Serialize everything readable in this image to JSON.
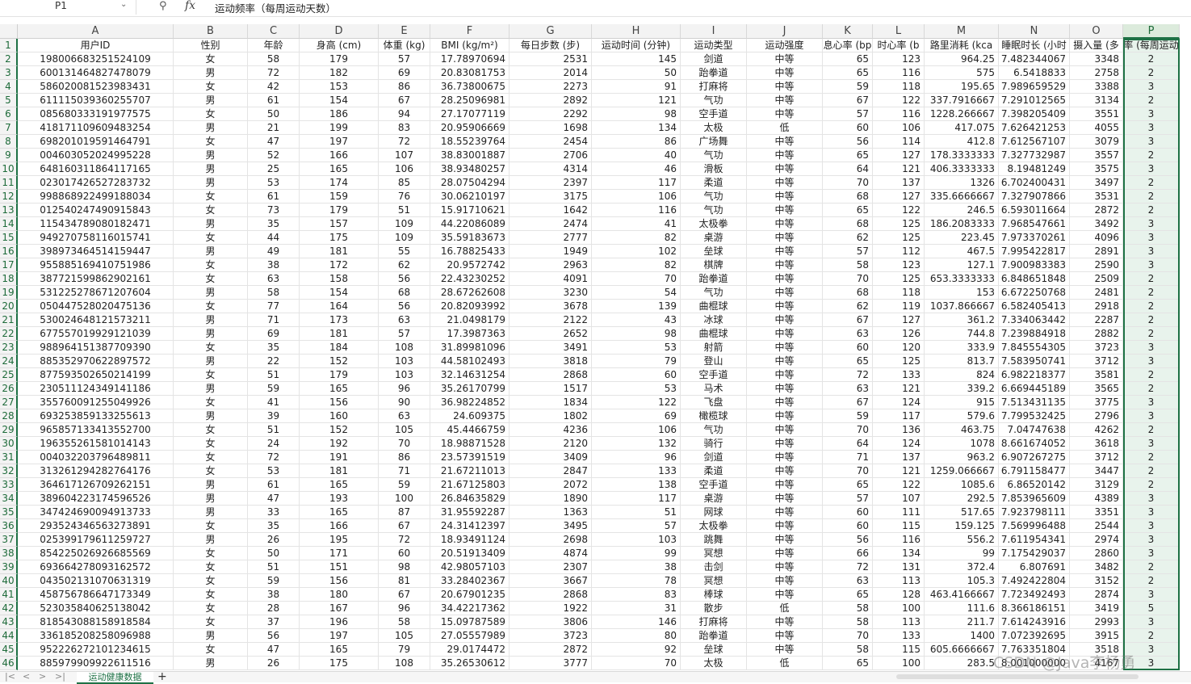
{
  "formula_bar": {
    "name_box": "P1",
    "fx": "fx",
    "formula": "运动频率（每周运动天数）"
  },
  "columns": [
    "A",
    "B",
    "C",
    "D",
    "E",
    "F",
    "G",
    "H",
    "I",
    "J",
    "K",
    "L",
    "M",
    "N",
    "O",
    "P"
  ],
  "headers": [
    "用户ID",
    "性别",
    "年龄",
    "身高 (cm)",
    "体重 (kg)",
    "BMI (kg/m²)",
    "每日步数 (步)",
    "运动时间 (分钟)",
    "运动类型",
    "运动强度",
    "息心率 (bp",
    "时心率 (b",
    "路里消耗 (kca",
    "睡眠时长 (小时",
    "摄入量 (多",
    "率 (每周运动"
  ],
  "rows": [
    [
      "198006683251524109",
      "女",
      "58",
      "179",
      "57",
      "17.78970694",
      "2531",
      "145",
      "剑道",
      "中等",
      "65",
      "123",
      "964.25",
      "7.482344067",
      "3348",
      "2"
    ],
    [
      "600131464827478079",
      "男",
      "72",
      "182",
      "69",
      "20.83081753",
      "2014",
      "50",
      "跆拳道",
      "中等",
      "65",
      "116",
      "575",
      "6.5418833",
      "2758",
      "2"
    ],
    [
      "586020081523983431",
      "女",
      "42",
      "153",
      "86",
      "36.73800675",
      "2273",
      "91",
      "打麻将",
      "中等",
      "59",
      "118",
      "195.65",
      "7.989659529",
      "3388",
      "3"
    ],
    [
      "611115039360255707",
      "男",
      "61",
      "154",
      "67",
      "28.25096981",
      "2892",
      "121",
      "气功",
      "中等",
      "67",
      "122",
      "337.7916667",
      "7.291012565",
      "3134",
      "2"
    ],
    [
      "085680333191977575",
      "女",
      "50",
      "186",
      "94",
      "27.17077119",
      "2292",
      "98",
      "空手道",
      "中等",
      "57",
      "116",
      "1228.266667",
      "7.398205409",
      "3551",
      "3"
    ],
    [
      "418171109609483254",
      "男",
      "21",
      "199",
      "83",
      "20.95906669",
      "1698",
      "134",
      "太极",
      "低",
      "60",
      "106",
      "417.075",
      "7.626421253",
      "4055",
      "3"
    ],
    [
      "698201019591464791",
      "女",
      "47",
      "197",
      "72",
      "18.55239764",
      "2454",
      "86",
      "广场舞",
      "中等",
      "56",
      "114",
      "412.8",
      "7.612567107",
      "3079",
      "3"
    ],
    [
      "004603052024995228",
      "男",
      "52",
      "166",
      "107",
      "38.83001887",
      "2706",
      "40",
      "气功",
      "中等",
      "65",
      "127",
      "178.3333333",
      "7.327732987",
      "3557",
      "2"
    ],
    [
      "648160311864117165",
      "男",
      "25",
      "165",
      "106",
      "38.93480257",
      "4314",
      "46",
      "滑板",
      "中等",
      "64",
      "121",
      "406.3333333",
      "8.19481249",
      "3575",
      "3"
    ],
    [
      "023017426527283732",
      "男",
      "53",
      "174",
      "85",
      "28.07504294",
      "2397",
      "117",
      "柔道",
      "中等",
      "70",
      "137",
      "1326",
      "6.702400431",
      "3497",
      "2"
    ],
    [
      "998868922499188034",
      "女",
      "61",
      "159",
      "76",
      "30.06210197",
      "3175",
      "106",
      "气功",
      "中等",
      "68",
      "127",
      "335.6666667",
      "7.327907866",
      "3531",
      "2"
    ],
    [
      "012540247490915843",
      "女",
      "73",
      "179",
      "51",
      "15.91710621",
      "1642",
      "116",
      "气功",
      "中等",
      "65",
      "122",
      "246.5",
      "6.593011664",
      "2872",
      "2"
    ],
    [
      "115434789080182471",
      "男",
      "35",
      "157",
      "109",
      "44.22086089",
      "2474",
      "41",
      "太极拳",
      "中等",
      "68",
      "125",
      "186.2083333",
      "7.968547661",
      "3492",
      "3"
    ],
    [
      "949270758116015741",
      "女",
      "44",
      "175",
      "109",
      "35.59183673",
      "2777",
      "82",
      "桌游",
      "中等",
      "62",
      "125",
      "223.45",
      "7.973370261",
      "4096",
      "3"
    ],
    [
      "398973464514159447",
      "男",
      "49",
      "181",
      "55",
      "16.78825433",
      "1949",
      "102",
      "垒球",
      "中等",
      "57",
      "112",
      "467.5",
      "7.995422817",
      "2891",
      "3"
    ],
    [
      "955885169410751986",
      "女",
      "38",
      "172",
      "62",
      "20.9572742",
      "2963",
      "82",
      "棋牌",
      "中等",
      "58",
      "123",
      "127.1",
      "7.900983383",
      "2590",
      "3"
    ],
    [
      "387721599862902161",
      "女",
      "63",
      "158",
      "56",
      "22.43230252",
      "4091",
      "70",
      "跆拳道",
      "中等",
      "70",
      "125",
      "653.3333333",
      "6.848651848",
      "2509",
      "2"
    ],
    [
      "531225278671207604",
      "男",
      "58",
      "154",
      "68",
      "28.67262608",
      "3230",
      "54",
      "气功",
      "中等",
      "68",
      "118",
      "153",
      "6.672250768",
      "2481",
      "2"
    ],
    [
      "050447528020475136",
      "女",
      "77",
      "164",
      "56",
      "20.82093992",
      "3678",
      "139",
      "曲棍球",
      "中等",
      "62",
      "119",
      "1037.866667",
      "6.582405413",
      "2918",
      "2"
    ],
    [
      "530024648121573211",
      "男",
      "71",
      "173",
      "63",
      "21.0498179",
      "2122",
      "43",
      "冰球",
      "中等",
      "67",
      "127",
      "361.2",
      "7.334063442",
      "2287",
      "2"
    ],
    [
      "677557019929121039",
      "男",
      "69",
      "181",
      "57",
      "17.3987363",
      "2652",
      "98",
      "曲棍球",
      "中等",
      "63",
      "126",
      "744.8",
      "7.239884918",
      "2882",
      "2"
    ],
    [
      "988964151387709390",
      "女",
      "35",
      "184",
      "108",
      "31.89981096",
      "3491",
      "53",
      "射箭",
      "中等",
      "60",
      "120",
      "333.9",
      "7.845554305",
      "3723",
      "3"
    ],
    [
      "885352970622897572",
      "男",
      "22",
      "152",
      "103",
      "44.58102493",
      "3818",
      "79",
      "登山",
      "中等",
      "65",
      "125",
      "813.7",
      "7.583950741",
      "3712",
      "3"
    ],
    [
      "877593502650214199",
      "女",
      "51",
      "179",
      "103",
      "32.14631254",
      "2868",
      "60",
      "空手道",
      "中等",
      "72",
      "133",
      "824",
      "6.982218377",
      "3581",
      "2"
    ],
    [
      "230511124349141186",
      "男",
      "59",
      "165",
      "96",
      "35.26170799",
      "1517",
      "53",
      "马术",
      "中等",
      "63",
      "121",
      "339.2",
      "6.669445189",
      "3565",
      "2"
    ],
    [
      "355760091255049926",
      "女",
      "41",
      "156",
      "90",
      "36.98224852",
      "1834",
      "122",
      "飞盘",
      "中等",
      "67",
      "124",
      "915",
      "7.513431135",
      "3775",
      "3"
    ],
    [
      "693253859133255613",
      "男",
      "39",
      "160",
      "63",
      "24.609375",
      "1802",
      "69",
      "橄榄球",
      "中等",
      "59",
      "117",
      "579.6",
      "7.799532425",
      "2796",
      "3"
    ],
    [
      "965857133413552700",
      "女",
      "51",
      "152",
      "105",
      "45.4466759",
      "4236",
      "106",
      "气功",
      "中等",
      "70",
      "136",
      "463.75",
      "7.04747638",
      "4262",
      "2"
    ],
    [
      "196355261581014143",
      "女",
      "24",
      "192",
      "70",
      "18.98871528",
      "2120",
      "132",
      "骑行",
      "中等",
      "64",
      "124",
      "1078",
      "8.661674052",
      "3618",
      "3"
    ],
    [
      "004032203796489811",
      "女",
      "72",
      "191",
      "86",
      "23.57391519",
      "3409",
      "96",
      "剑道",
      "中等",
      "71",
      "137",
      "963.2",
      "6.907267275",
      "3712",
      "2"
    ],
    [
      "313261294282764176",
      "女",
      "53",
      "181",
      "71",
      "21.67211013",
      "2847",
      "133",
      "柔道",
      "中等",
      "70",
      "121",
      "1259.066667",
      "6.791158477",
      "3447",
      "2"
    ],
    [
      "364617126709262151",
      "男",
      "61",
      "165",
      "59",
      "21.67125803",
      "2072",
      "138",
      "空手道",
      "中等",
      "65",
      "122",
      "1085.6",
      "6.86520142",
      "3129",
      "2"
    ],
    [
      "389604223174596526",
      "男",
      "47",
      "193",
      "100",
      "26.84635829",
      "1890",
      "117",
      "桌游",
      "中等",
      "57",
      "107",
      "292.5",
      "7.853965609",
      "4389",
      "3"
    ],
    [
      "347424690094913733",
      "男",
      "33",
      "165",
      "87",
      "31.95592287",
      "1363",
      "51",
      "网球",
      "中等",
      "60",
      "111",
      "517.65",
      "7.923798111",
      "3351",
      "3"
    ],
    [
      "293524346563273891",
      "女",
      "35",
      "166",
      "67",
      "24.31412397",
      "3495",
      "57",
      "太极拳",
      "中等",
      "60",
      "115",
      "159.125",
      "7.569996488",
      "2544",
      "3"
    ],
    [
      "025399179611259727",
      "男",
      "26",
      "195",
      "72",
      "18.93491124",
      "2698",
      "103",
      "跳舞",
      "中等",
      "56",
      "116",
      "556.2",
      "7.611954341",
      "2974",
      "3"
    ],
    [
      "854225026926685569",
      "女",
      "50",
      "171",
      "60",
      "20.51913409",
      "4874",
      "99",
      "冥想",
      "中等",
      "66",
      "134",
      "99",
      "7.175429037",
      "2860",
      "3"
    ],
    [
      "693664278093162572",
      "女",
      "51",
      "151",
      "98",
      "42.98057103",
      "2307",
      "38",
      "击剑",
      "中等",
      "72",
      "131",
      "372.4",
      "6.807691",
      "3482",
      "2"
    ],
    [
      "043502131070631319",
      "女",
      "59",
      "156",
      "81",
      "33.28402367",
      "3667",
      "78",
      "冥想",
      "中等",
      "63",
      "113",
      "105.3",
      "7.492422804",
      "3152",
      "2"
    ],
    [
      "458756786647173349",
      "女",
      "38",
      "180",
      "67",
      "20.67901235",
      "2868",
      "83",
      "棒球",
      "中等",
      "65",
      "128",
      "463.4166667",
      "7.723492493",
      "2874",
      "3"
    ],
    [
      "523035840625138042",
      "女",
      "28",
      "167",
      "96",
      "34.42217362",
      "1922",
      "31",
      "散步",
      "低",
      "58",
      "100",
      "111.6",
      "8.366186151",
      "3419",
      "5"
    ],
    [
      "818543088158918584",
      "女",
      "37",
      "196",
      "58",
      "15.09787589",
      "3806",
      "146",
      "打麻将",
      "中等",
      "58",
      "113",
      "211.7",
      "7.614243916",
      "2993",
      "3"
    ],
    [
      "336185208258096988",
      "男",
      "56",
      "197",
      "105",
      "27.05557989",
      "3723",
      "80",
      "跆拳道",
      "中等",
      "70",
      "133",
      "1400",
      "7.072392695",
      "3915",
      "2"
    ],
    [
      "952226272101234615",
      "女",
      "47",
      "165",
      "79",
      "29.0174472",
      "2872",
      "92",
      "垒球",
      "中等",
      "58",
      "115",
      "605.6666667",
      "7.763351804",
      "3518",
      "3"
    ],
    [
      "885979909922611516",
      "男",
      "26",
      "175",
      "108",
      "35.26530612",
      "3777",
      "70",
      "太极",
      "低",
      "65",
      "100",
      "283.5",
      "8.001000000",
      "4167",
      "3"
    ]
  ],
  "sheet_tabs": {
    "active": "运动健康数据",
    "add": "+"
  },
  "nav": {
    "first": "|<",
    "prev": "<",
    "next": ">",
    "last": ">|"
  },
  "watermark": "CSDN @Java李杨勇",
  "colors": {
    "accent": "#1e7145",
    "header_bg": "#f3f3f3",
    "grid_line": "#e4e4e4",
    "selected_col_bg": "#e8f3ec"
  }
}
